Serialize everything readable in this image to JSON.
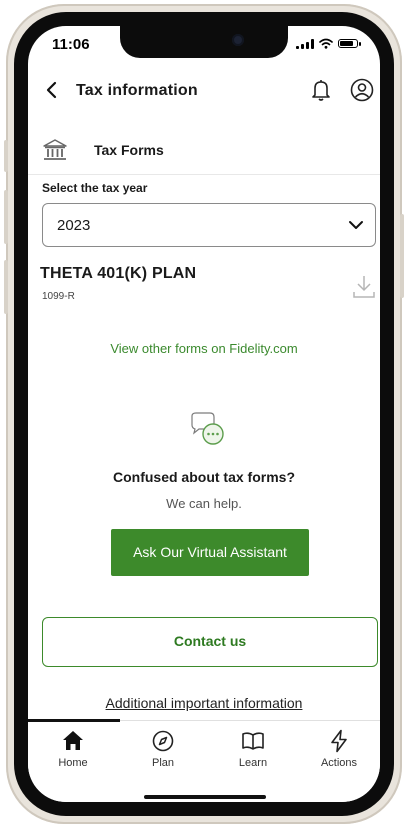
{
  "status_bar": {
    "time": "11:06",
    "battery_level": 0.85
  },
  "header": {
    "title": "Tax information",
    "icons": [
      "back-icon",
      "bell-icon",
      "profile-icon"
    ]
  },
  "section": {
    "label": "Tax Forms",
    "icon": "bank-icon"
  },
  "tax_year": {
    "label": "Select the tax year",
    "selected": "2023"
  },
  "plan": {
    "name": "THETA 401(K) PLAN",
    "form": "1099-R"
  },
  "links": {
    "other_forms": "View other forms on Fidelity.com"
  },
  "help": {
    "title": "Confused about tax forms?",
    "subtitle": "We can help.",
    "assistant_button": "Ask Our Virtual Assistant",
    "contact_button": "Contact us"
  },
  "footer_link": "Additional important information",
  "tabs": [
    {
      "label": "Home",
      "icon": "home-icon",
      "active": true
    },
    {
      "label": "Plan",
      "icon": "compass-icon",
      "active": false
    },
    {
      "label": "Learn",
      "icon": "book-icon",
      "active": false
    },
    {
      "label": "Actions",
      "icon": "lightning-icon",
      "active": false
    }
  ],
  "colors": {
    "accent_green": "#3d8a2b",
    "link_green": "#3b8a2e"
  }
}
